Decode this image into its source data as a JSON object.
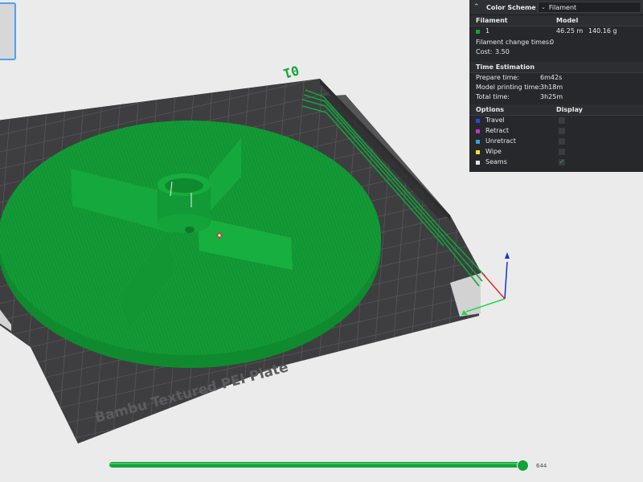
{
  "scene": {
    "plate_label": "Bambu Textured PEI Plate",
    "plate_number": "01"
  },
  "legend": {
    "header_label": "Color Scheme",
    "scheme_value": "Filament",
    "filament_header": "Filament",
    "model_header": "Model",
    "filament_id": "1",
    "filament_color": "#13a33a",
    "length": "46.25 m",
    "weight": "140.16 g",
    "change_label": "Filament change times:",
    "change_value": "0",
    "cost_label": "Cost:",
    "cost_value": "3.50",
    "time_header": "Time Estimation",
    "times": [
      {
        "label": "Prepare time:",
        "value": "6m42s"
      },
      {
        "label": "Model printing time:",
        "value": "3h18m"
      },
      {
        "label": "Total time:",
        "value": "3h25m"
      }
    ],
    "options_header": "Options",
    "display_header": "Display",
    "options": [
      {
        "label": "Travel",
        "color": "#2d4bd2",
        "checked": false
      },
      {
        "label": "Retract",
        "color": "#c531c9",
        "checked": false
      },
      {
        "label": "Unretract",
        "color": "#3aa0d8",
        "checked": false
      },
      {
        "label": "Wipe",
        "color": "#f4e52b",
        "checked": false
      },
      {
        "label": "Seams",
        "color": "#e8e8e8",
        "checked": true
      }
    ]
  },
  "slider": {
    "layer": "644",
    "progress": 1.0
  }
}
